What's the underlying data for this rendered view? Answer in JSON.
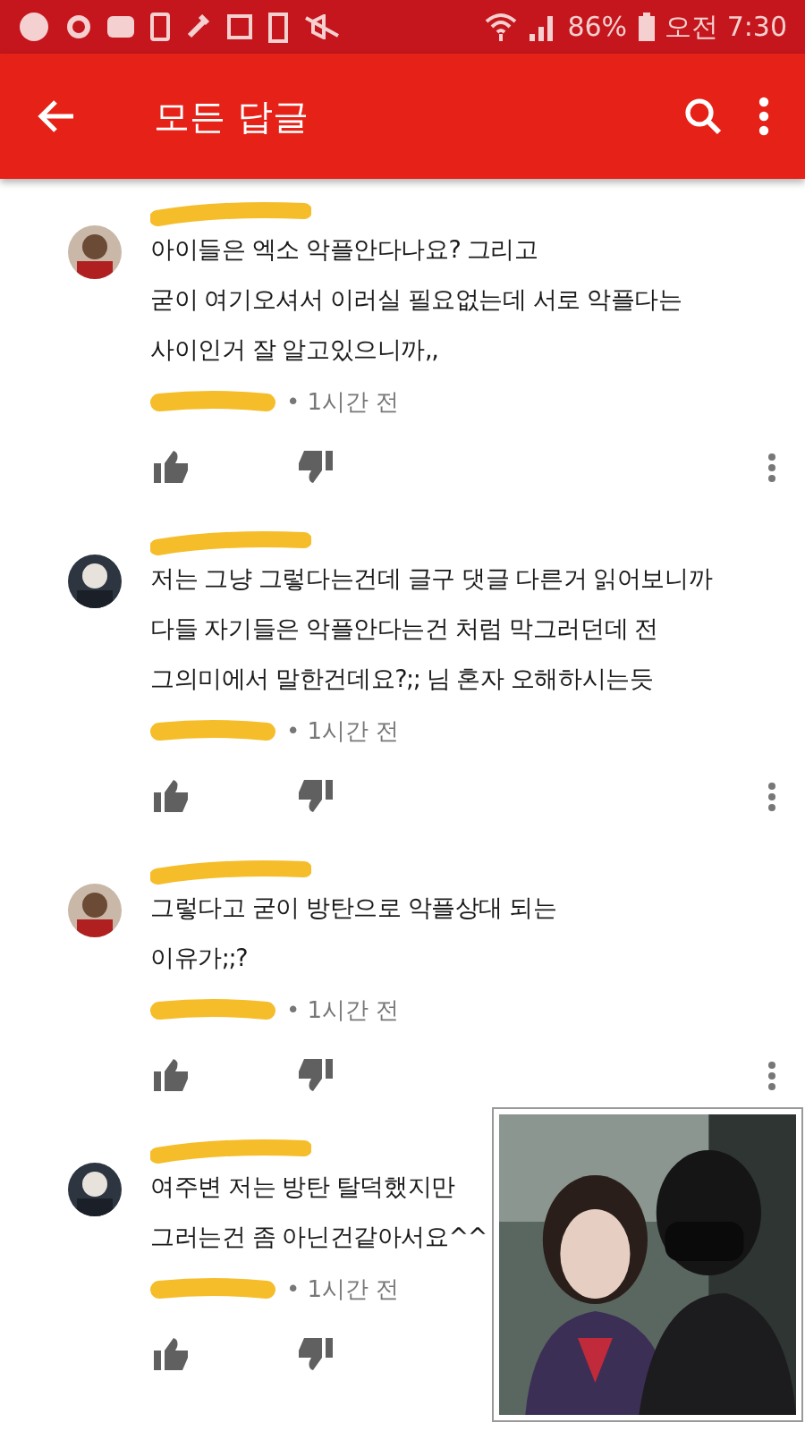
{
  "status_bar": {
    "battery": "86%",
    "time": "오전 7:30"
  },
  "app_bar": {
    "title": "모든 답글"
  },
  "comments": [
    {
      "lines": [
        "아이들은 엑소 악플안다나요? 그리고",
        "굳이 여기오셔서 이러실 필요없는데 서로 악플다는",
        "사이인거 잘 알고있으니까,,"
      ],
      "time": "• 1시간 전",
      "menu_shown": true
    },
    {
      "lines": [
        "저는 그냥 그렇다는건데 글구 댓글 다른거 읽어보니까",
        "다들 자기들은 악플안다는건 처럼 막그러던데 전",
        "그의미에서 말한건데요?;; 님 혼자 오해하시는듯"
      ],
      "time": "• 1시간 전",
      "menu_shown": true
    },
    {
      "lines": [
        "그렇다고 굳이 방탄으로 악플상대 되는",
        "이유가;;?"
      ],
      "time": "• 1시간 전",
      "menu_shown": true
    },
    {
      "lines": [
        "여주변 저는 방탄 탈덕했지만",
        "그러는건 좀 아닌건같아서요^^"
      ],
      "time": "• 1시간 전",
      "menu_shown": false
    }
  ]
}
